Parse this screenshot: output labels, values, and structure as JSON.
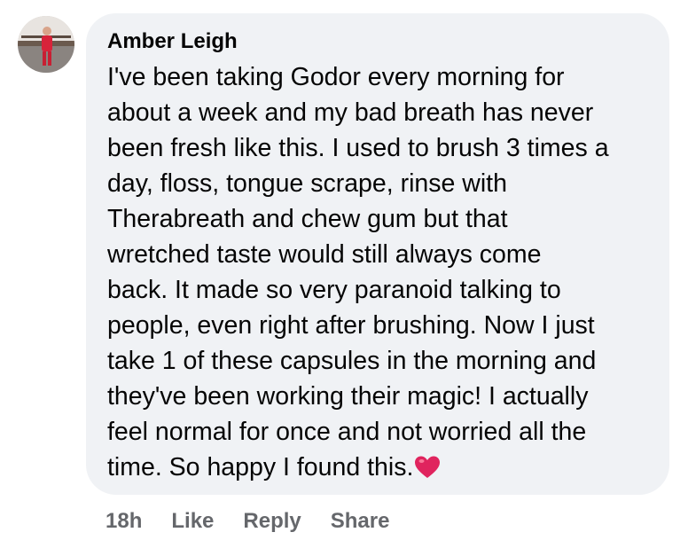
{
  "comment": {
    "author": "Amber Leigh",
    "text_lines": [
      "I've been taking Godor every morning for",
      "about a week and my bad breath has never",
      "been fresh like this. I used to brush 3 times a",
      "day, floss, tongue scrape, rinse with",
      "Therabreath and chew gum but that",
      "wretched taste would still always come",
      "back. It made so very paranoid talking to",
      "people, even right after brushing. Now I just",
      "take 1 of these capsules in the morning and",
      "they've been working their magic! I actually",
      "feel normal for once and not worried all the",
      "time. So happy I found this."
    ],
    "emoji": "heart-emoji"
  },
  "actions": {
    "timestamp": "18h",
    "like": "Like",
    "reply": "Reply",
    "share": "Share"
  },
  "colors": {
    "bubble_bg": "#f0f2f5",
    "text": "#050505",
    "action_text": "#65676b",
    "heart": "#e0245e"
  }
}
